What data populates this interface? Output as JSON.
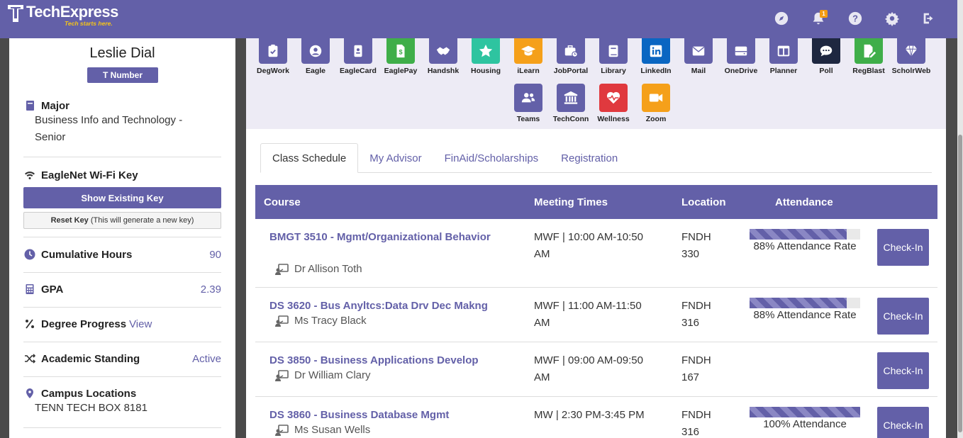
{
  "app": {
    "name": "TechExpress",
    "tagline": "Tech starts here."
  },
  "topbar": {
    "notification_count": "1"
  },
  "profile": {
    "name": "Leslie Dial",
    "tnumber_label": "T Number",
    "major_label": "Major",
    "major_value": "Business Info and Technology - Senior",
    "wifi_label": "EagleNet Wi-Fi Key",
    "show_key_label": "Show Existing Key",
    "reset_key_label": "Reset Key",
    "reset_key_note": "(This will generate a new key)",
    "hours_label": "Cumulative Hours",
    "hours_value": "90",
    "gpa_label": "GPA",
    "gpa_value": "2.39",
    "degree_label": "Degree Progress",
    "degree_link": "View",
    "standing_label": "Academic Standing",
    "standing_value": "Active",
    "campus_label": "Campus Locations",
    "campus_value": "TENN TECH BOX 8181"
  },
  "apps": [
    {
      "label": "DegWork",
      "color": "#6360a8",
      "icon": "clipboard-check-icon"
    },
    {
      "label": "Eagle",
      "color": "#6360a8",
      "icon": "user-circle-icon"
    },
    {
      "label": "EagleCard",
      "color": "#6360a8",
      "icon": "id-card-icon"
    },
    {
      "label": "EaglePay",
      "color": "#3fae49",
      "icon": "dollar-doc-icon"
    },
    {
      "label": "Handshk",
      "color": "#6360a8",
      "icon": "handshake-icon"
    },
    {
      "label": "Housing",
      "color": "#2ec4a0",
      "icon": "star-icon"
    },
    {
      "label": "iLearn",
      "color": "#f5a01a",
      "icon": "graduation-cap-icon"
    },
    {
      "label": "JobPortal",
      "color": "#6360a8",
      "icon": "briefcase-icon"
    },
    {
      "label": "Library",
      "color": "#6360a8",
      "icon": "book-icon"
    },
    {
      "label": "LinkedIn",
      "color": "#0a66c2",
      "icon": "linkedin-icon"
    },
    {
      "label": "Mail",
      "color": "#6360a8",
      "icon": "envelope-icon"
    },
    {
      "label": "OneDrive",
      "color": "#6360a8",
      "icon": "hard-drive-icon"
    },
    {
      "label": "Planner",
      "color": "#6360a8",
      "icon": "columns-icon"
    },
    {
      "label": "Poll",
      "color": "#1e2740",
      "icon": "comment-icon"
    },
    {
      "label": "RegBlast",
      "color": "#3fae49",
      "icon": "file-pen-icon"
    },
    {
      "label": "ScholrWeb",
      "color": "#6360a8",
      "icon": "diamond-icon"
    },
    {
      "label": "Teams",
      "color": "#6360a8",
      "icon": "users-icon"
    },
    {
      "label": "TechConn",
      "color": "#6360a8",
      "icon": "landmark-icon"
    },
    {
      "label": "Wellness",
      "color": "#e0393e",
      "icon": "heart-pulse-icon"
    },
    {
      "label": "Zoom",
      "color": "#f5a01a",
      "icon": "video-icon"
    }
  ],
  "tabs": [
    "Class Schedule",
    "My Advisor",
    "FinAid/Scholarships",
    "Registration"
  ],
  "schedule": {
    "headers": {
      "course": "Course",
      "meeting": "Meeting Times",
      "location": "Location",
      "attendance": "Attendance"
    },
    "checkin_label": "Check-In",
    "rows": [
      {
        "course": "BMGT 3510 - Mgmt/Organizational Behavior",
        "instructor": "Dr Allison Toth",
        "meeting": "MWF | 10:00 AM-10:50 AM",
        "location": "FNDH 330",
        "attendance": 0.88,
        "attendance_label": "88% Attendance Rate"
      },
      {
        "course": "DS 3620 - Bus Anyltcs:Data Drv Dec Makng",
        "instructor": "Ms Tracy Black",
        "meeting": "MWF | 11:00 AM-11:50 AM",
        "location": "FNDH 316",
        "attendance": 0.88,
        "attendance_label": "88% Attendance Rate"
      },
      {
        "course": "DS 3850 - Business Applications Develop",
        "instructor": "Dr William Clary",
        "meeting": "MWF | 09:00 AM-09:50 AM",
        "location": "FNDH 167",
        "attendance": null,
        "attendance_label": ""
      },
      {
        "course": "DS 3860 - Business Database Mgmt",
        "instructor": "Ms Susan Wells",
        "meeting": "MW | 2:30 PM-3:45 PM",
        "location": "FNDH 316",
        "attendance": 1.0,
        "attendance_label": "100% Attendance"
      }
    ]
  }
}
